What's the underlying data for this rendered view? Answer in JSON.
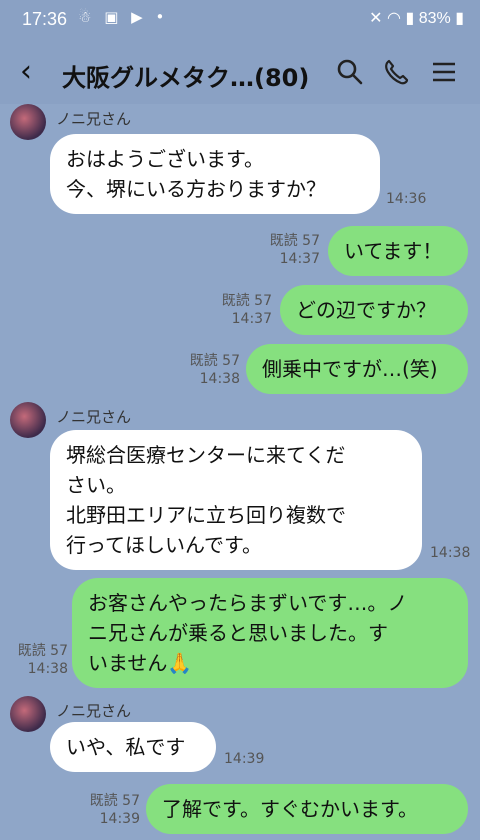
{
  "status": {
    "time": "17:36",
    "battery": "83%"
  },
  "header": {
    "title": "大阪グルメタク…(80)",
    "back_icon": "chevron-left-icon",
    "search_icon": "search-icon",
    "call_icon": "phone-icon",
    "menu_icon": "menu-icon"
  },
  "messages": [
    {
      "type": "in",
      "sender": "ノニ兄さん",
      "lines": [
        "おはようございます。",
        "今、堺にいる方おりますか？"
      ],
      "time": "14:36"
    },
    {
      "type": "out",
      "read": "既読 57",
      "time": "14:37",
      "lines": [
        "いてます！"
      ]
    },
    {
      "type": "out",
      "read": "既読 57",
      "time": "14:37",
      "lines": [
        "どの辺ですか？"
      ]
    },
    {
      "type": "out",
      "read": "既読 57",
      "time": "14:38",
      "lines": [
        "側乗中ですが…(笑)"
      ]
    },
    {
      "type": "in",
      "sender": "ノニ兄さん",
      "lines": [
        "堺総合医療センターに来てくだ",
        "さい。",
        "北野田エリアに立ち回り複数で",
        "行ってほしいんです。"
      ],
      "time": "14:38"
    },
    {
      "type": "out",
      "read": "既読 57",
      "time": "14:38",
      "lines": [
        "お客さんやったらまずいです…。ノ",
        "ニ兄さんが乗ると思いました。す",
        "いません🙏"
      ]
    },
    {
      "type": "in",
      "sender": "ノニ兄さん",
      "lines": [
        "いや、私です"
      ],
      "time": "14:39"
    },
    {
      "type": "out",
      "read": "既読 57",
      "time": "14:39",
      "lines": [
        "了解です。すぐむかいます。"
      ]
    }
  ]
}
